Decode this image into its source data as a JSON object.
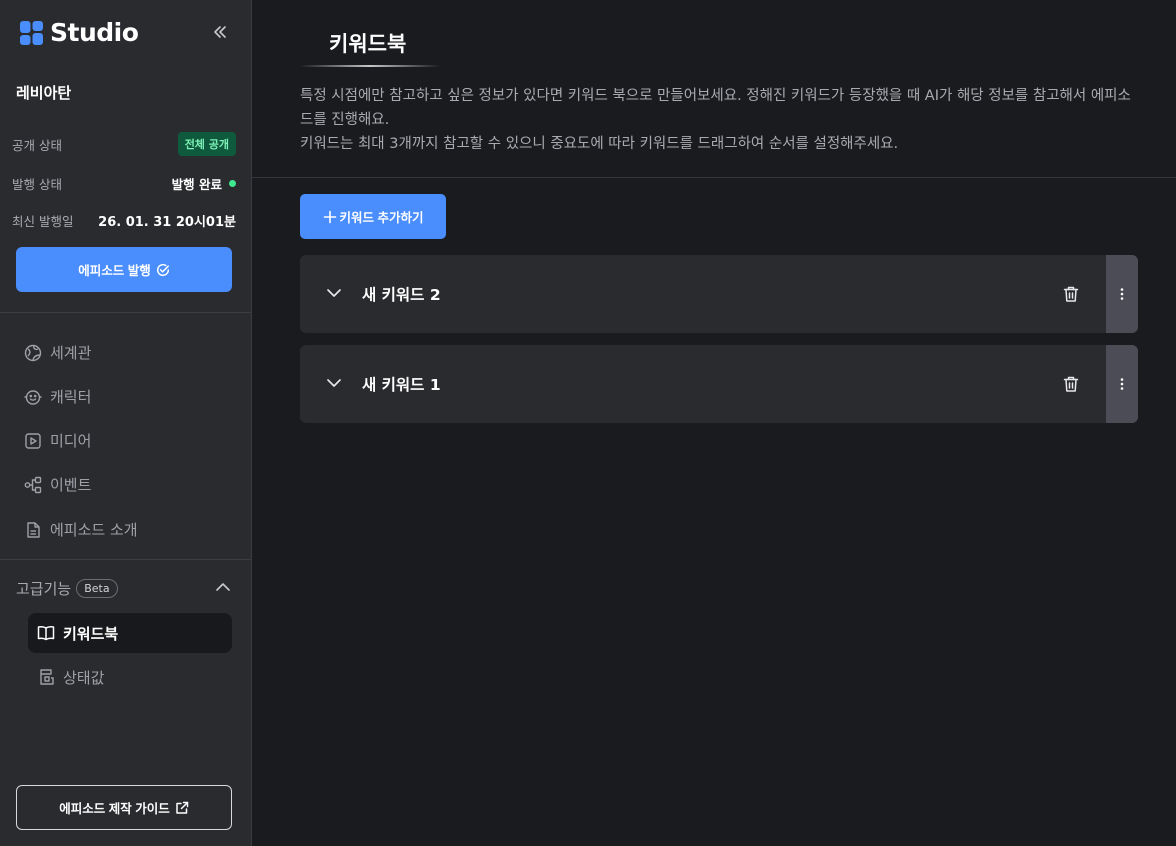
{
  "app": {
    "name": "Studio"
  },
  "project": {
    "name": "레비아탄",
    "visibility_label": "공개 상태",
    "visibility_value": "전체 공개",
    "publish_state_label": "발행 상태",
    "publish_state_value": "발행 완료",
    "last_published_label": "최신 발행일",
    "last_published_value": "26. 01. 31 20시01분",
    "publish_button": "에피소드 발행"
  },
  "nav": {
    "items": [
      {
        "label": "세계관",
        "icon": "world-icon"
      },
      {
        "label": "캐릭터",
        "icon": "character-icon"
      },
      {
        "label": "미디어",
        "icon": "media-icon"
      },
      {
        "label": "이벤트",
        "icon": "event-icon"
      },
      {
        "label": "에피소드 소개",
        "icon": "document-icon"
      }
    ]
  },
  "advanced": {
    "label": "고급기능",
    "badge": "Beta",
    "items": [
      {
        "label": "키워드북",
        "icon": "book-icon",
        "active": true
      },
      {
        "label": "상태값",
        "icon": "status-icon",
        "active": false
      }
    ]
  },
  "guide_button": "에피소드 제작 가이드",
  "main": {
    "title": "키워드북",
    "description_line1": "특정 시점에만 참고하고 싶은 정보가 있다면 키워드 북으로 만들어보세요. 정해진 키워드가 등장했을 때 AI가 해당 정보를 참고해서 에피소드를 진행해요.",
    "description_line2": "키워드는 최대 3개까지 참고할 수 있으니 중요도에 따라 키워드를 드래그하여 순서를 설정해주세요.",
    "add_button": "키워드 추가하기",
    "keywords": [
      {
        "title": "새 키워드 2"
      },
      {
        "title": "새 키워드 1"
      }
    ]
  },
  "colors": {
    "accent": "#4a8dfc",
    "sidebar_bg": "#2a2b2f",
    "main_bg": "#1a1b1e",
    "status_green": "#3ee88f"
  }
}
